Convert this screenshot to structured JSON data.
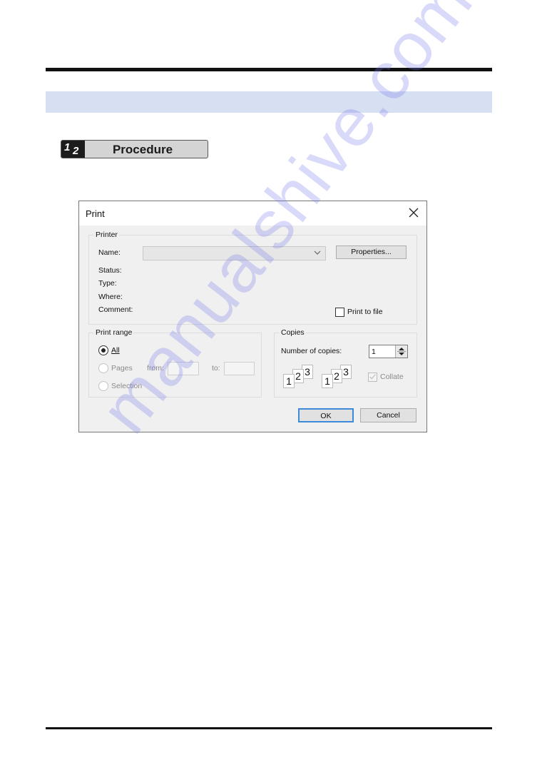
{
  "procedure": {
    "badge_num_1": "1",
    "badge_num_2": "2",
    "label": "Procedure"
  },
  "dialog": {
    "title": "Print",
    "close_icon": "close-icon",
    "printer_group": {
      "legend": "Printer",
      "name_label": "Name:",
      "name_value": "",
      "properties_button": "Properties...",
      "status_label": "Status:",
      "type_label": "Type:",
      "where_label": "Where:",
      "comment_label": "Comment:",
      "print_to_file_label": "Print to file",
      "print_to_file_checked": false
    },
    "print_range_group": {
      "legend": "Print range",
      "all_label": "All",
      "all_selected": true,
      "pages_label": "Pages",
      "from_label": "from:",
      "from_value": "",
      "to_label": "to:",
      "to_value": "",
      "selection_label": "Selection"
    },
    "copies_group": {
      "legend": "Copies",
      "number_label": "Number of copies:",
      "number_value": "1",
      "collate_icon_pages": [
        "1",
        "2",
        "3"
      ],
      "collate_label": "Collate",
      "collate_checked": true,
      "collate_enabled": false
    },
    "ok_button": "OK",
    "cancel_button": "Cancel"
  },
  "watermark": "manualshive.com",
  "colors": {
    "section_band": "#d7e0f2",
    "ok_focus_border": "#3c8ad8",
    "watermark": "#7878eb"
  }
}
